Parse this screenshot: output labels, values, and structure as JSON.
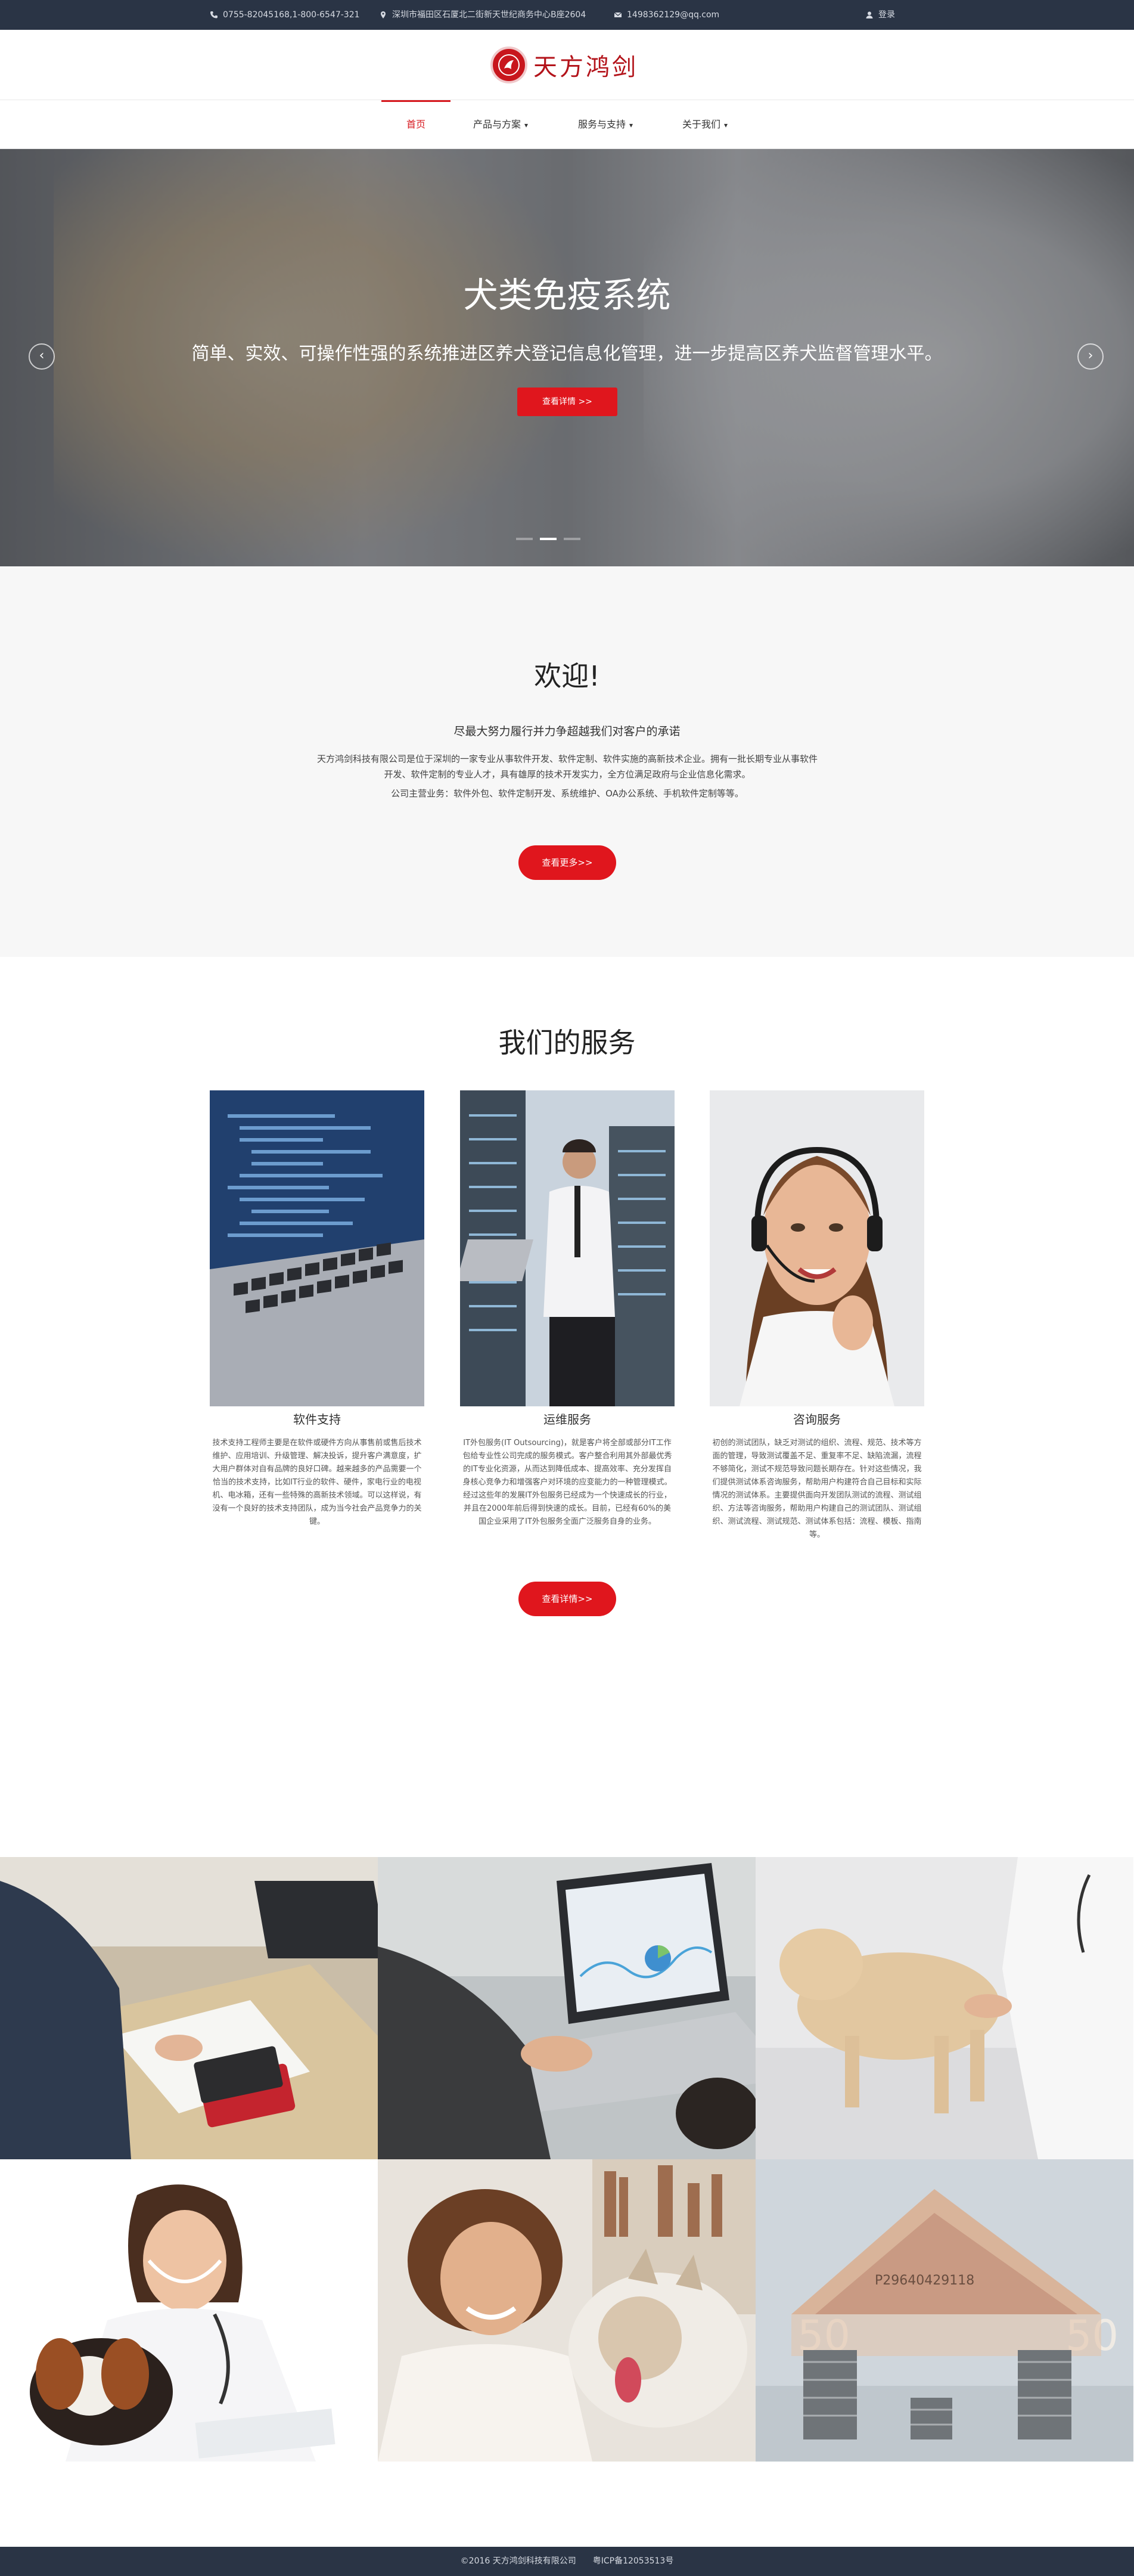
{
  "topbar": {
    "phone": "0755-82045168,1-800-6547-321",
    "address": "深圳市福田区石厦北二街新天世纪商务中心B座2604",
    "email": "1498362129@qq.com",
    "login": "登录"
  },
  "header": {
    "logo_text": "天方鸿剑"
  },
  "nav": {
    "items": [
      {
        "label": "首页"
      },
      {
        "label": "产品与方案"
      },
      {
        "label": "服务与支持"
      },
      {
        "label": "关于我们"
      }
    ]
  },
  "hero": {
    "title": "犬类免疫系统",
    "subtitle": "简单、实效、可操作性强的系统推进区养犬登记信息化管理，进一步提高区养犬监督管理水平。",
    "button": "查看详情 >>",
    "prev": "‹",
    "next": "›",
    "slide_count": 3,
    "active_slide": 2
  },
  "welcome": {
    "title": "欢迎!",
    "lead": "尽最大努力履行并力争超越我们对客户的承诺",
    "para": "天方鸿剑科技有限公司是位于深圳的一家专业从事软件开发、软件定制、软件实施的高新技术企业。拥有一批长期专业从事软件开发、软件定制的专业人才，具有雄厚的技术开发实力，全方位满足政府与企业信息化需求。",
    "para2": "公司主营业务：软件外包、软件定制开发、系统维护、OA办公系统、手机软件定制等等。",
    "button": "查看更多>>"
  },
  "services": {
    "title": "我们的服务",
    "cards": [
      {
        "title": "软件支持",
        "desc": "技术支持工程师主要是在软件或硬件方向从事售前或售后技术维护、应用培训、升级管理、解决投诉，提升客户满意度，扩大用户群体对自有品牌的良好口碑。越来越多的产品需要一个恰当的技术支持，比如IT行业的软件、硬件，家电行业的电视机、电冰箱，还有一些特殊的高新技术领域。可以这样说，有没有一个良好的技术支持团队，成为当今社会产品竞争力的关键。"
      },
      {
        "title": "运维服务",
        "desc": "IT外包服务(IT Outsourcing)，就是客户将全部或部分IT工作包给专业性公司完成的服务模式。客户整合利用其外部最优秀的IT专业化资源，从而达到降低成本、提高效率、充分发挥自身核心竞争力和增强客户对环境的应变能力的一种管理模式。经过这些年的发展IT外包服务已经成为一个快速成长的行业，并且在2000年前后得到快速的成长。目前，已经有60%的美国企业采用了IT外包服务全面广泛服务自身的业务。"
      },
      {
        "title": "咨询服务",
        "desc": "初创的测试团队，缺乏对测试的组织、流程、规范、技术等方面的管理，导致测试覆盖不足、重复率不足、缺陷流漏，流程不够简化，测试不规范导致问题长期存在。针对这些情况，我们提供测试体系咨询服务，帮助用户构建符合自己目标和实际情况的测试体系。主要提供面向开发团队测试的流程、测试组织、方法等咨询服务，帮助用户构建自己的测试团队、测试组织、测试流程、测试规范、测试体系包括：流程、模板、指南等。"
      }
    ],
    "button": "查看详情>>"
  },
  "footer": {
    "text": "©2016 天方鸿剑科技有限公司　　粤ICP备12053513号"
  }
}
